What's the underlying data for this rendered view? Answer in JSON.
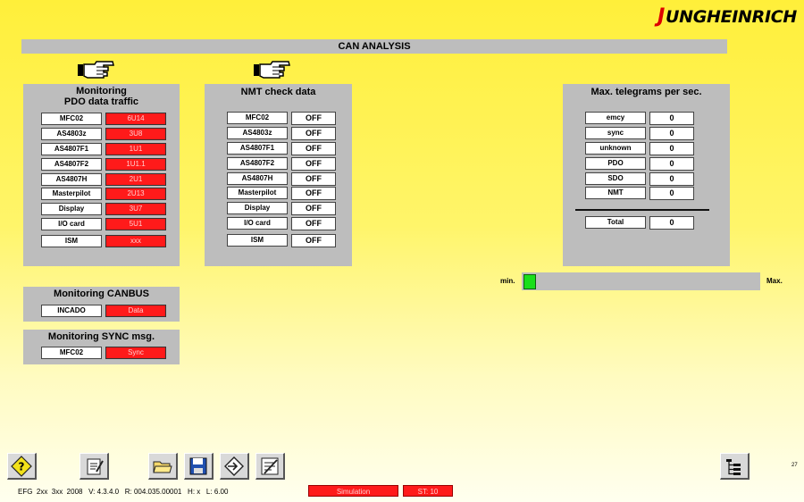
{
  "brand": {
    "logo_first": "J",
    "logo_rest": "UNGHEINRICH"
  },
  "header": {
    "title": "CAN ANALYSIS"
  },
  "pdo": {
    "title_line1": "Monitoring",
    "title_line2": "PDO data traffic",
    "rows": [
      {
        "label": "MFC02",
        "value": "6U14"
      },
      {
        "label": "AS4803z",
        "value": "3U8"
      },
      {
        "label": "AS4807F1",
        "value": "1U1"
      },
      {
        "label": "AS4807F2",
        "value": "1U1.1"
      },
      {
        "label": "AS4807H",
        "value": "2U1"
      },
      {
        "label": "Masterpilot",
        "value": "2U13"
      },
      {
        "label": "Display",
        "value": "3U7"
      },
      {
        "label": "I/O card",
        "value": "5U1"
      },
      {
        "label": "ISM",
        "value": "xxx"
      }
    ]
  },
  "nmt": {
    "title": "NMT check data",
    "rows": [
      {
        "label": "MFC02",
        "value": "OFF"
      },
      {
        "label": "AS4803z",
        "value": "OFF"
      },
      {
        "label": "AS4807F1",
        "value": "OFF"
      },
      {
        "label": "AS4807F2",
        "value": "OFF"
      },
      {
        "label": "AS4807H",
        "value": "OFF"
      },
      {
        "label": "Masterpilot",
        "value": "OFF"
      },
      {
        "label": "Display",
        "value": "OFF"
      },
      {
        "label": "I/O card",
        "value": "OFF"
      },
      {
        "label": "ISM",
        "value": "OFF"
      }
    ]
  },
  "telegrams": {
    "title": "Max. telegrams per sec.",
    "rows": [
      {
        "label": "emcy",
        "value": "0"
      },
      {
        "label": "sync",
        "value": "0"
      },
      {
        "label": "unknown",
        "value": "0"
      },
      {
        "label": "PDO",
        "value": "0"
      },
      {
        "label": "SDO",
        "value": "0"
      },
      {
        "label": "NMT",
        "value": "0"
      }
    ],
    "total_label": "Total",
    "total_value": "0"
  },
  "canbus": {
    "title": "Monitoring CANBUS",
    "label": "INCADO",
    "value": "Data"
  },
  "sync": {
    "title": "Monitoring SYNC msg.",
    "label": "MFC02",
    "value": "Sync"
  },
  "gauge": {
    "min_label": "min.",
    "max_label": "Max.",
    "level": 0.0
  },
  "page_number": "27",
  "status": {
    "info": "EFG  2xx  3xx  2008   V: 4.3.4.0   R: 004.035.00001   H: x   L: 6.00",
    "simulation": "Simulation",
    "st": "ST: 10"
  },
  "colors": {
    "alarm_red": "#ff1a1a",
    "ok_green": "#1adf1a",
    "panel_gray": "#bdbdbd",
    "brand_red": "#dd0000"
  },
  "toolbar_icons": [
    "help-icon",
    "notepad-icon",
    "open-folder-icon",
    "save-disk-icon",
    "navigate-diamond-icon",
    "edit-document-icon",
    "tree-structure-icon"
  ]
}
